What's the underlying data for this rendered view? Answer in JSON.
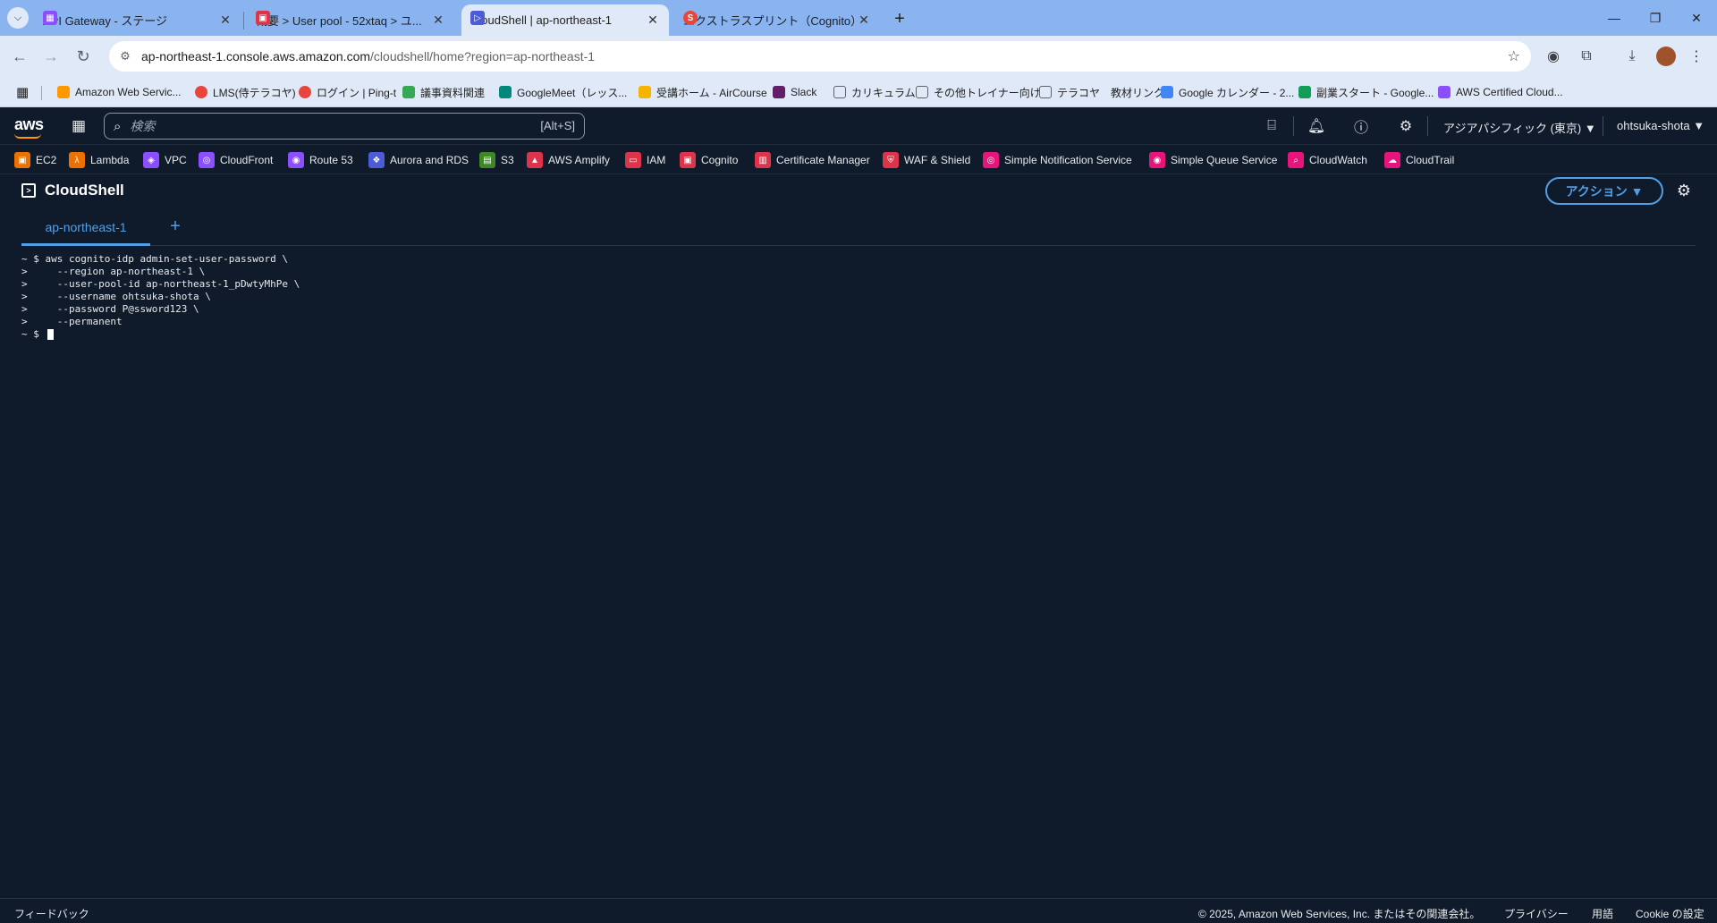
{
  "browser": {
    "tabs": [
      {
        "title": "API Gateway - ステージ",
        "favicon_color": "#8c4fff"
      },
      {
        "title": "概要 > User pool - 52xtaq > ユ...",
        "favicon_color": "#dd344c"
      },
      {
        "title": "CloudShell | ap-northeast-1",
        "favicon_color": "#4d5bd6"
      },
      {
        "title": "エクストラスプリント（Cognito）| ...",
        "favicon_color": "#e8453c"
      }
    ],
    "address_host": "ap-northeast-1.console.aws.amazon.com",
    "address_path": "/cloudshell/home?region=ap-northeast-1",
    "bookmarks": [
      {
        "label": "Amazon Web Servic...",
        "color": "#ff9900"
      },
      {
        "label": "LMS(侍テラコヤ)",
        "color": "#e8453c"
      },
      {
        "label": "ログイン | Ping-t",
        "color": "#e8453c"
      },
      {
        "label": "議事資料関連",
        "color": "#34a853"
      },
      {
        "label": "GoogleMeet（レッス...",
        "color": "#00897b"
      },
      {
        "label": "受講ホーム - AirCourse",
        "color": "#f4b400"
      },
      {
        "label": "Slack",
        "color": "#611f69"
      },
      {
        "label": "カリキュラム",
        "color": "#5f6368"
      },
      {
        "label": "その他トレイナー向け",
        "color": "#5f6368"
      },
      {
        "label": "テラコヤ　教材リンク",
        "color": "#5f6368"
      },
      {
        "label": "Google カレンダー - 2...",
        "color": "#4285f4"
      },
      {
        "label": "副業スタート - Google...",
        "color": "#0f9d58"
      },
      {
        "label": "AWS Certified Cloud...",
        "color": "#8c4fff"
      }
    ]
  },
  "aws_header": {
    "logo": "aws",
    "search_placeholder": "検索",
    "search_shortcut": "[Alt+S]",
    "region": "アジアパシフィック (東京) ▼",
    "user": "ohtsuka-shota ▼"
  },
  "favorites": [
    {
      "label": "EC2",
      "color": "#ed7100"
    },
    {
      "label": "Lambda",
      "color": "#ed7100"
    },
    {
      "label": "VPC",
      "color": "#8c4fff"
    },
    {
      "label": "CloudFront",
      "color": "#8c4fff"
    },
    {
      "label": "Route 53",
      "color": "#8c4fff"
    },
    {
      "label": "Aurora and RDS",
      "color": "#4d5bd6"
    },
    {
      "label": "S3",
      "color": "#3f8624"
    },
    {
      "label": "AWS Amplify",
      "color": "#dd344c"
    },
    {
      "label": "IAM",
      "color": "#dd344c"
    },
    {
      "label": "Cognito",
      "color": "#dd344c"
    },
    {
      "label": "Certificate Manager",
      "color": "#dd344c"
    },
    {
      "label": "WAF & Shield",
      "color": "#dd344c"
    },
    {
      "label": "Simple Notification Service",
      "color": "#e7157b"
    },
    {
      "label": "Simple Queue Service",
      "color": "#e7157b"
    },
    {
      "label": "CloudWatch",
      "color": "#e7157b"
    },
    {
      "label": "CloudTrail",
      "color": "#e7157b"
    }
  ],
  "page": {
    "title": "CloudShell",
    "action_button": "アクション ▼",
    "terminal_tab": "ap-northeast-1",
    "add_tab": "+"
  },
  "terminal": {
    "lines": [
      "~ $ aws cognito-idp admin-set-user-password \\",
      ">     --region ap-northeast-1 \\",
      ">     --user-pool-id ap-northeast-1_pDwtyMhPe \\",
      ">     --username ohtsuka-shota \\",
      ">     --password P@ssword123 \\",
      ">     --permanent"
    ],
    "prompt": "~ $ "
  },
  "footer": {
    "feedback": "フィードバック",
    "copyright": "© 2025, Amazon Web Services, Inc. またはその関連会社。",
    "privacy": "プライバシー",
    "terms": "用語",
    "cookie": "Cookie の設定"
  }
}
